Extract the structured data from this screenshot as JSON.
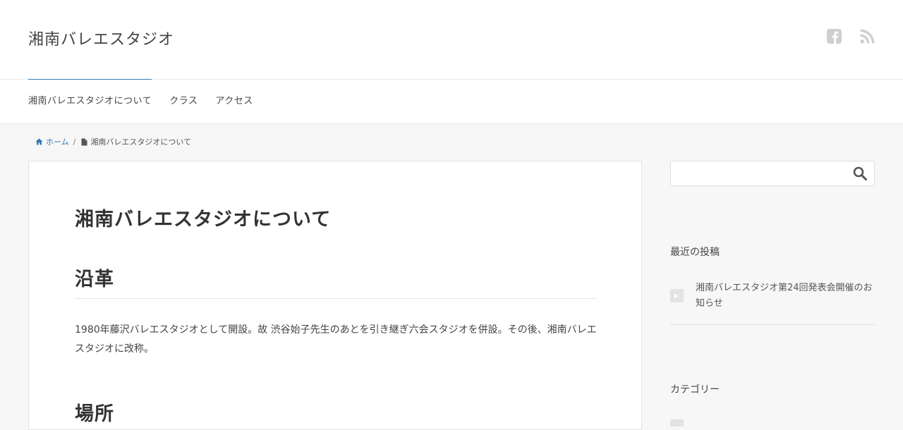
{
  "site": {
    "title": "湘南バレエスタジオ"
  },
  "social": {
    "icons": [
      "facebook-icon",
      "rss-icon"
    ]
  },
  "nav": {
    "items": [
      "湘南バレエスタジオについて",
      "クラス",
      "アクセス"
    ]
  },
  "breadcrumb": {
    "home": "ホーム",
    "separator": "/",
    "current": "湘南バレエスタジオについて"
  },
  "main": {
    "title": "湘南バレエスタジオについて",
    "section1_heading": "沿革",
    "section1_text": "1980年藤沢バレエスタジオとして開設。故 渋谷始子先生のあとを引き継ぎ六会スタジオを併設。その後、湘南バレエスタジオに改称。",
    "section2_heading": "場所"
  },
  "sidebar": {
    "search_placeholder": "",
    "recent_title": "最近の投稿",
    "recent_posts": [
      "湘南バレエスタジオ第24回発表会開催のお知らせ"
    ],
    "categories_title": "カテゴリー"
  },
  "colors": {
    "accent": "#337ab7",
    "icon_gray": "#c9c9c9"
  }
}
